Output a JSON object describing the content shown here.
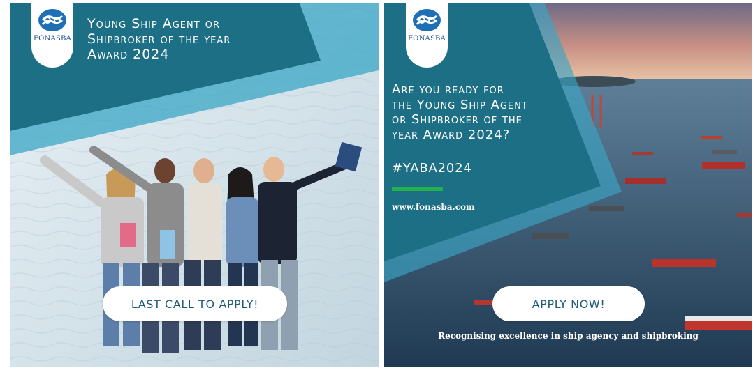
{
  "brand": {
    "logo_text": "FONASBA",
    "teal": "#1d6f86",
    "teal_light": "#3aa5c4",
    "green": "#22b14c"
  },
  "left_panel": {
    "title": "Young Ship Agent or\nShipbroker of the year\nAward 2024",
    "cta_label": "LAST CALL TO APPLY!"
  },
  "right_panel": {
    "title": "Are you ready for\nthe Young Ship Agent\nor Shipbroker of the\nyear Award 2024?",
    "hashtag": "#YABA2024",
    "website": "www.fonasba.com",
    "cta_label": "APPLY NOW!",
    "tagline": "Recognising excellence in ship agency and shipbroking"
  }
}
